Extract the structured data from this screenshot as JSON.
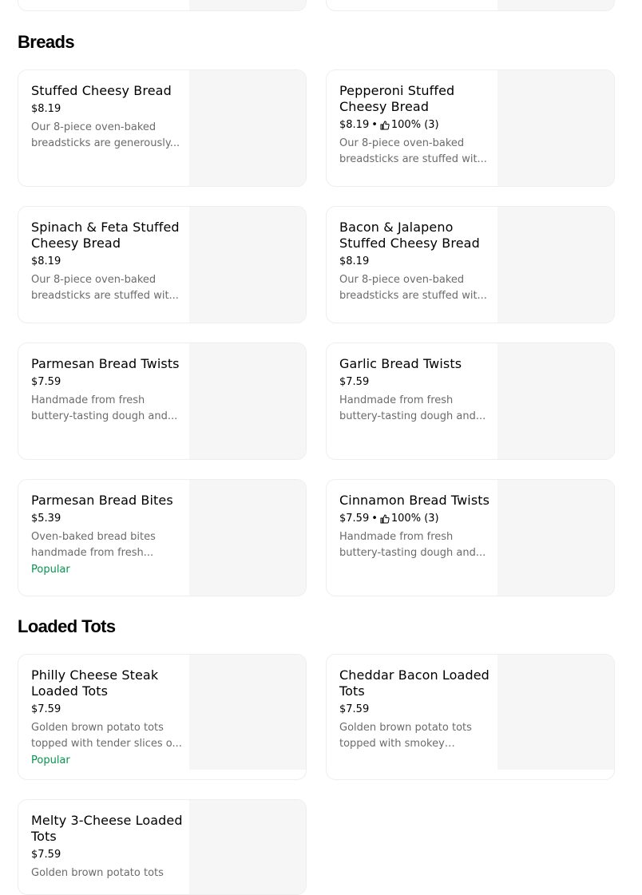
{
  "sections": {
    "breads": {
      "title": "Breads",
      "items": [
        {
          "name": "Stuffed Cheesy Bread",
          "price": "$8.19",
          "desc": "Our 8-piece oven-baked breadsticks are generously..."
        },
        {
          "name": "Pepperoni Stuffed Cheesy Bread",
          "price": "$8.19",
          "rating": "100% (3)",
          "desc": "Our 8-piece oven-baked breadsticks are stuffed wit..."
        },
        {
          "name": "Spinach & Feta Stuffed Cheesy Bread",
          "price": "$8.19",
          "desc": "Our 8-piece oven-baked breadsticks are stuffed wit..."
        },
        {
          "name": "Bacon & Jalapeno Stuffed Cheesy Bread",
          "price": "$8.19",
          "desc": "Our 8-piece oven-baked breadsticks are stuffed wit..."
        },
        {
          "name": "Parmesan Bread Twists",
          "price": "$7.59",
          "desc": "Handmade from fresh buttery-tasting dough and..."
        },
        {
          "name": "Garlic Bread Twists",
          "price": "$7.59",
          "desc": "Handmade from fresh buttery-tasting dough and..."
        },
        {
          "name": "Parmesan Bread Bites",
          "price": "$5.39",
          "desc": "Oven-baked bread bites handmade from fresh...",
          "badge": "Popular"
        },
        {
          "name": "Cinnamon Bread Twists",
          "price": "$7.59",
          "rating": "100% (3)",
          "desc": "Handmade from fresh buttery-tasting dough and..."
        }
      ]
    },
    "loaded_tots": {
      "title": "Loaded Tots",
      "items": [
        {
          "name": "Philly Cheese Steak Loaded Tots",
          "price": "$7.59",
          "desc": "Golden brown potato tots topped with tender slices o...",
          "badge": "Popular"
        },
        {
          "name": "Cheddar Bacon Loaded Tots",
          "price": "$7.59",
          "desc": "Golden brown potato tots topped with smokey bacon,..."
        },
        {
          "name": "Melty 3-Cheese Loaded Tots",
          "price": "$7.59",
          "desc": "Golden brown potato tots"
        }
      ]
    }
  },
  "colors": {
    "popular": "#05944f",
    "placeholder_image": "#f6f6f6",
    "description": "#6b6b6b"
  },
  "icons": {
    "rating": "thumbs-up-icon"
  }
}
